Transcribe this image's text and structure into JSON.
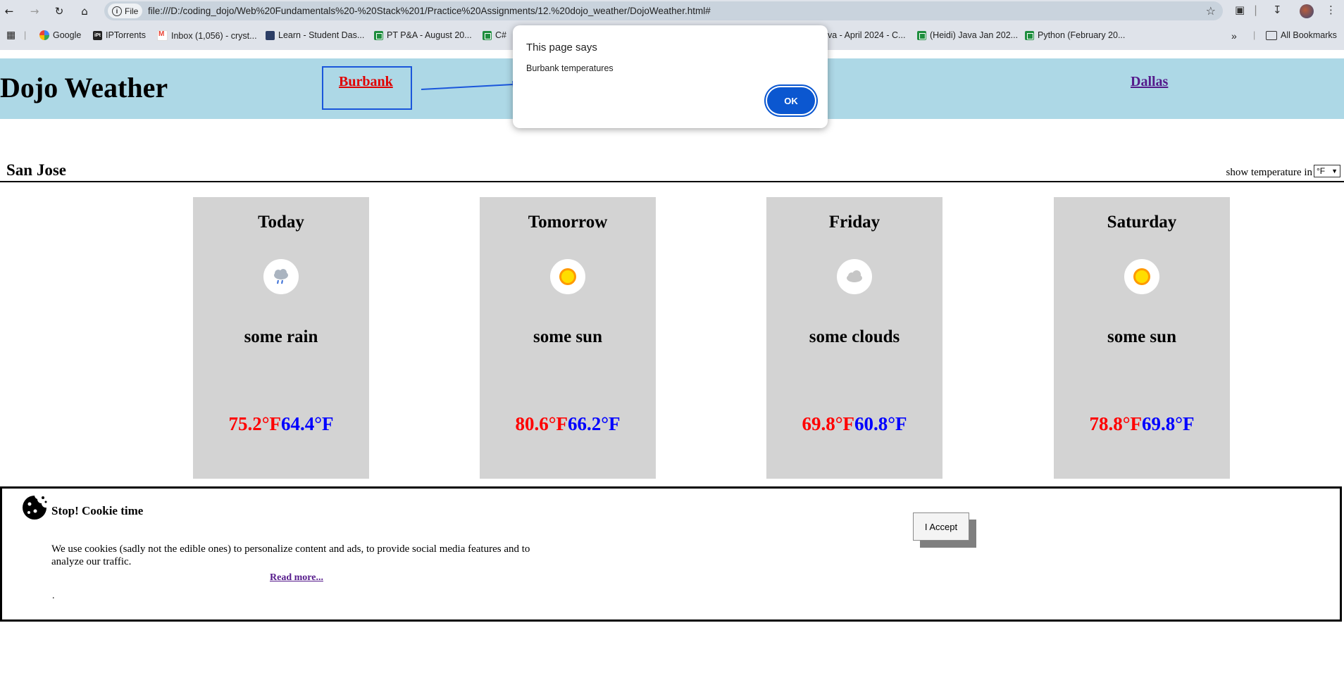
{
  "browser": {
    "file_label": "File",
    "url": "file:///D:/coding_dojo/Web%20Fundamentals%20-%20Stack%201/Practice%20Assignments/12.%20dojo_weather/DojoWeather.html#",
    "bookmarks": [
      {
        "label": "Google",
        "icon": "google-icon"
      },
      {
        "label": "IPTorrents",
        "icon": "iptorrents-icon"
      },
      {
        "label": "Inbox (1,056) - cryst...",
        "icon": "gmail-icon"
      },
      {
        "label": "Learn - Student Das...",
        "icon": "learn-icon"
      },
      {
        "label": "PT P&A - August 20...",
        "icon": "sheets-icon"
      },
      {
        "label": "C#",
        "icon": "sheets-icon"
      },
      {
        "label": "ava - April 2024 - C...",
        "icon": "sheets-icon"
      },
      {
        "label": "(Heidi) Java Jan 202...",
        "icon": "sheets-icon"
      },
      {
        "label": "Python (February 20...",
        "icon": "sheets-icon"
      }
    ],
    "all_bookmarks": "All Bookmarks"
  },
  "page": {
    "title": "Dojo Weather",
    "links": {
      "burbank": "Burbank",
      "dallas": "Dallas"
    },
    "city": "San Jose",
    "temp_label": "show temperature in",
    "unit": "°F",
    "forecast": [
      {
        "day": "Today",
        "icon": "rain-icon",
        "desc": "some rain",
        "high": "75.2°F",
        "low": "64.4°F"
      },
      {
        "day": "Tomorrow",
        "icon": "sun-icon",
        "desc": "some sun",
        "high": "80.6°F",
        "low": "66.2°F"
      },
      {
        "day": "Friday",
        "icon": "cloud-icon",
        "desc": "some clouds",
        "high": "69.8°F",
        "low": "60.8°F"
      },
      {
        "day": "Saturday",
        "icon": "sun-icon",
        "desc": "some sun",
        "high": "78.8°F",
        "low": "69.8°F"
      }
    ],
    "cookie": {
      "title": "Stop! Cookie time",
      "text": "We use cookies (sadly not the edible ones) to personalize content and ads, to provide social media features and to analyze our traffic.",
      "read_more": "Read more...",
      "dot": ".",
      "accept": "I Accept"
    }
  },
  "dialog": {
    "title": "This page says",
    "message": "Burbank temperatures",
    "ok": "OK"
  },
  "colors": {
    "header_bg": "#add8e6",
    "card_bg": "#d3d3d3",
    "high_temp": "#ff0000",
    "low_temp": "#0000ff",
    "dialog_button": "#0b57d0"
  }
}
